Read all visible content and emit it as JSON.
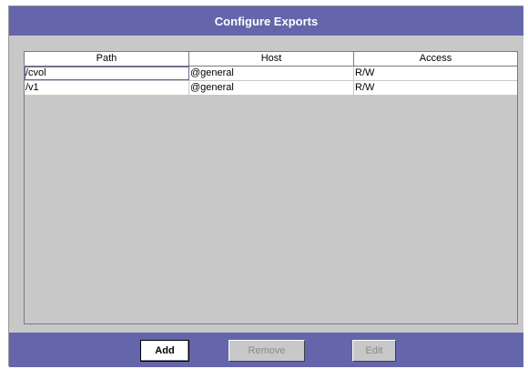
{
  "dialog": {
    "title": "Configure Exports"
  },
  "table": {
    "columns": [
      "Path",
      "Host",
      "Access"
    ],
    "rows": [
      {
        "path": "/cvol",
        "host": "@general",
        "access": "R/W"
      },
      {
        "path": "/v1",
        "host": "@general",
        "access": "R/W"
      }
    ]
  },
  "buttons": {
    "add": "Add",
    "remove": "Remove",
    "edit": "Edit"
  },
  "colors": {
    "accent": "#6465aa",
    "panel": "#c8c8c8"
  }
}
